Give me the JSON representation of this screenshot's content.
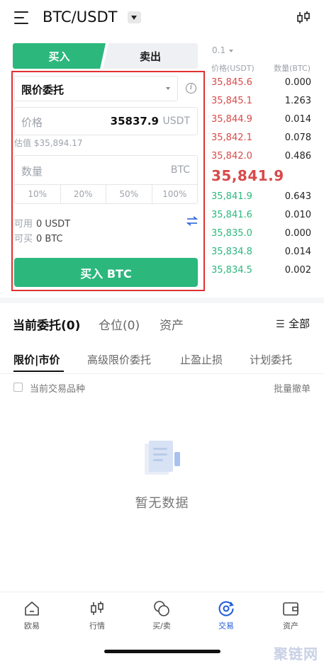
{
  "header": {
    "pair": "BTC/USDT",
    "menu_icon": "menu-icon",
    "chart_icon": "candlestick-icon"
  },
  "trade_tabs": {
    "buy": "买入",
    "sell": "卖出"
  },
  "form": {
    "order_type": "限价委托",
    "price_label": "价格",
    "price_value": "35837.9",
    "price_unit": "USDT",
    "estimate": "估值 $35,894.17",
    "quantity_label": "数量",
    "quantity_unit": "BTC",
    "percents": [
      "10%",
      "20%",
      "50%",
      "100%"
    ],
    "available_label": "可用",
    "available_value": "0 USDT",
    "buyable_label": "可买",
    "buyable_value": "0 BTC",
    "submit": "买入 BTC",
    "colors": {
      "buy": "#2cb77d",
      "sell_price": "#d84a4a",
      "highlight_border": "#e03131"
    }
  },
  "order_book": {
    "precision": "0.1",
    "price_header": "价格(USDT)",
    "qty_header": "数量(BTC)",
    "asks": [
      {
        "price": "35,845.6",
        "qty": "0.000"
      },
      {
        "price": "35,845.1",
        "qty": "1.263"
      },
      {
        "price": "35,844.9",
        "qty": "0.014"
      },
      {
        "price": "35,842.1",
        "qty": "0.078"
      },
      {
        "price": "35,842.0",
        "qty": "0.486"
      }
    ],
    "last_price": "35,841.9",
    "bids": [
      {
        "price": "35,841.9",
        "qty": "0.643"
      },
      {
        "price": "35,841.6",
        "qty": "0.010"
      },
      {
        "price": "35,835.0",
        "qty": "0.000"
      },
      {
        "price": "35,834.8",
        "qty": "0.014"
      },
      {
        "price": "35,834.5",
        "qty": "0.002"
      }
    ]
  },
  "orders": {
    "tabs": [
      "当前委托(0)",
      "仓位(0)",
      "资产"
    ],
    "filter": "全部",
    "sub_tabs": [
      "限价|市价",
      "高级限价委托",
      "止盈止损",
      "计划委托"
    ],
    "checkbox_label": "当前交易品种",
    "batch_cancel": "批量撤单",
    "empty_text": "暂无数据"
  },
  "bottom_nav": [
    {
      "label": "欧易",
      "icon": "home-icon"
    },
    {
      "label": "行情",
      "icon": "candlestick-icon"
    },
    {
      "label": "买/卖",
      "icon": "coins-icon"
    },
    {
      "label": "交易",
      "icon": "trade-icon",
      "active": true
    },
    {
      "label": "资产",
      "icon": "wallet-icon"
    }
  ],
  "watermark": "聚链网"
}
